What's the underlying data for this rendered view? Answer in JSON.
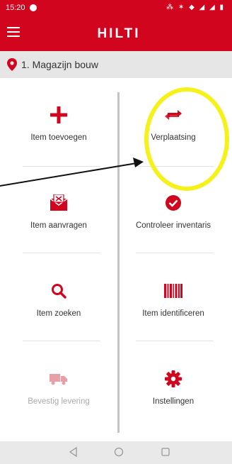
{
  "status": {
    "time": "15:20",
    "icons": "⁂ ✶ ◆ ◢ ◢ ▮"
  },
  "app": {
    "brand": "HILTI"
  },
  "location": {
    "label": "1. Magazijn bouw"
  },
  "tiles": [
    {
      "label": "Item toevoegen",
      "icon": "plus-icon",
      "enabled": true
    },
    {
      "label": "Verplaatsing",
      "icon": "transfer-icon",
      "enabled": true
    },
    {
      "label": "Item aanvragen",
      "icon": "request-envelope-icon",
      "enabled": true
    },
    {
      "label": "Controleer inventaris",
      "icon": "check-circle-icon",
      "enabled": true
    },
    {
      "label": "Item zoeken",
      "icon": "search-icon",
      "enabled": true
    },
    {
      "label": "Item identificeren",
      "icon": "barcode-icon",
      "enabled": true
    },
    {
      "label": "Bevestig levering",
      "icon": "truck-icon",
      "enabled": false
    },
    {
      "label": "Instellingen",
      "icon": "gear-icon",
      "enabled": true
    }
  ],
  "colors": {
    "brand": "#d2051e",
    "annotation_circle": "#f4f21a",
    "disabled": "#e8a0a8"
  }
}
